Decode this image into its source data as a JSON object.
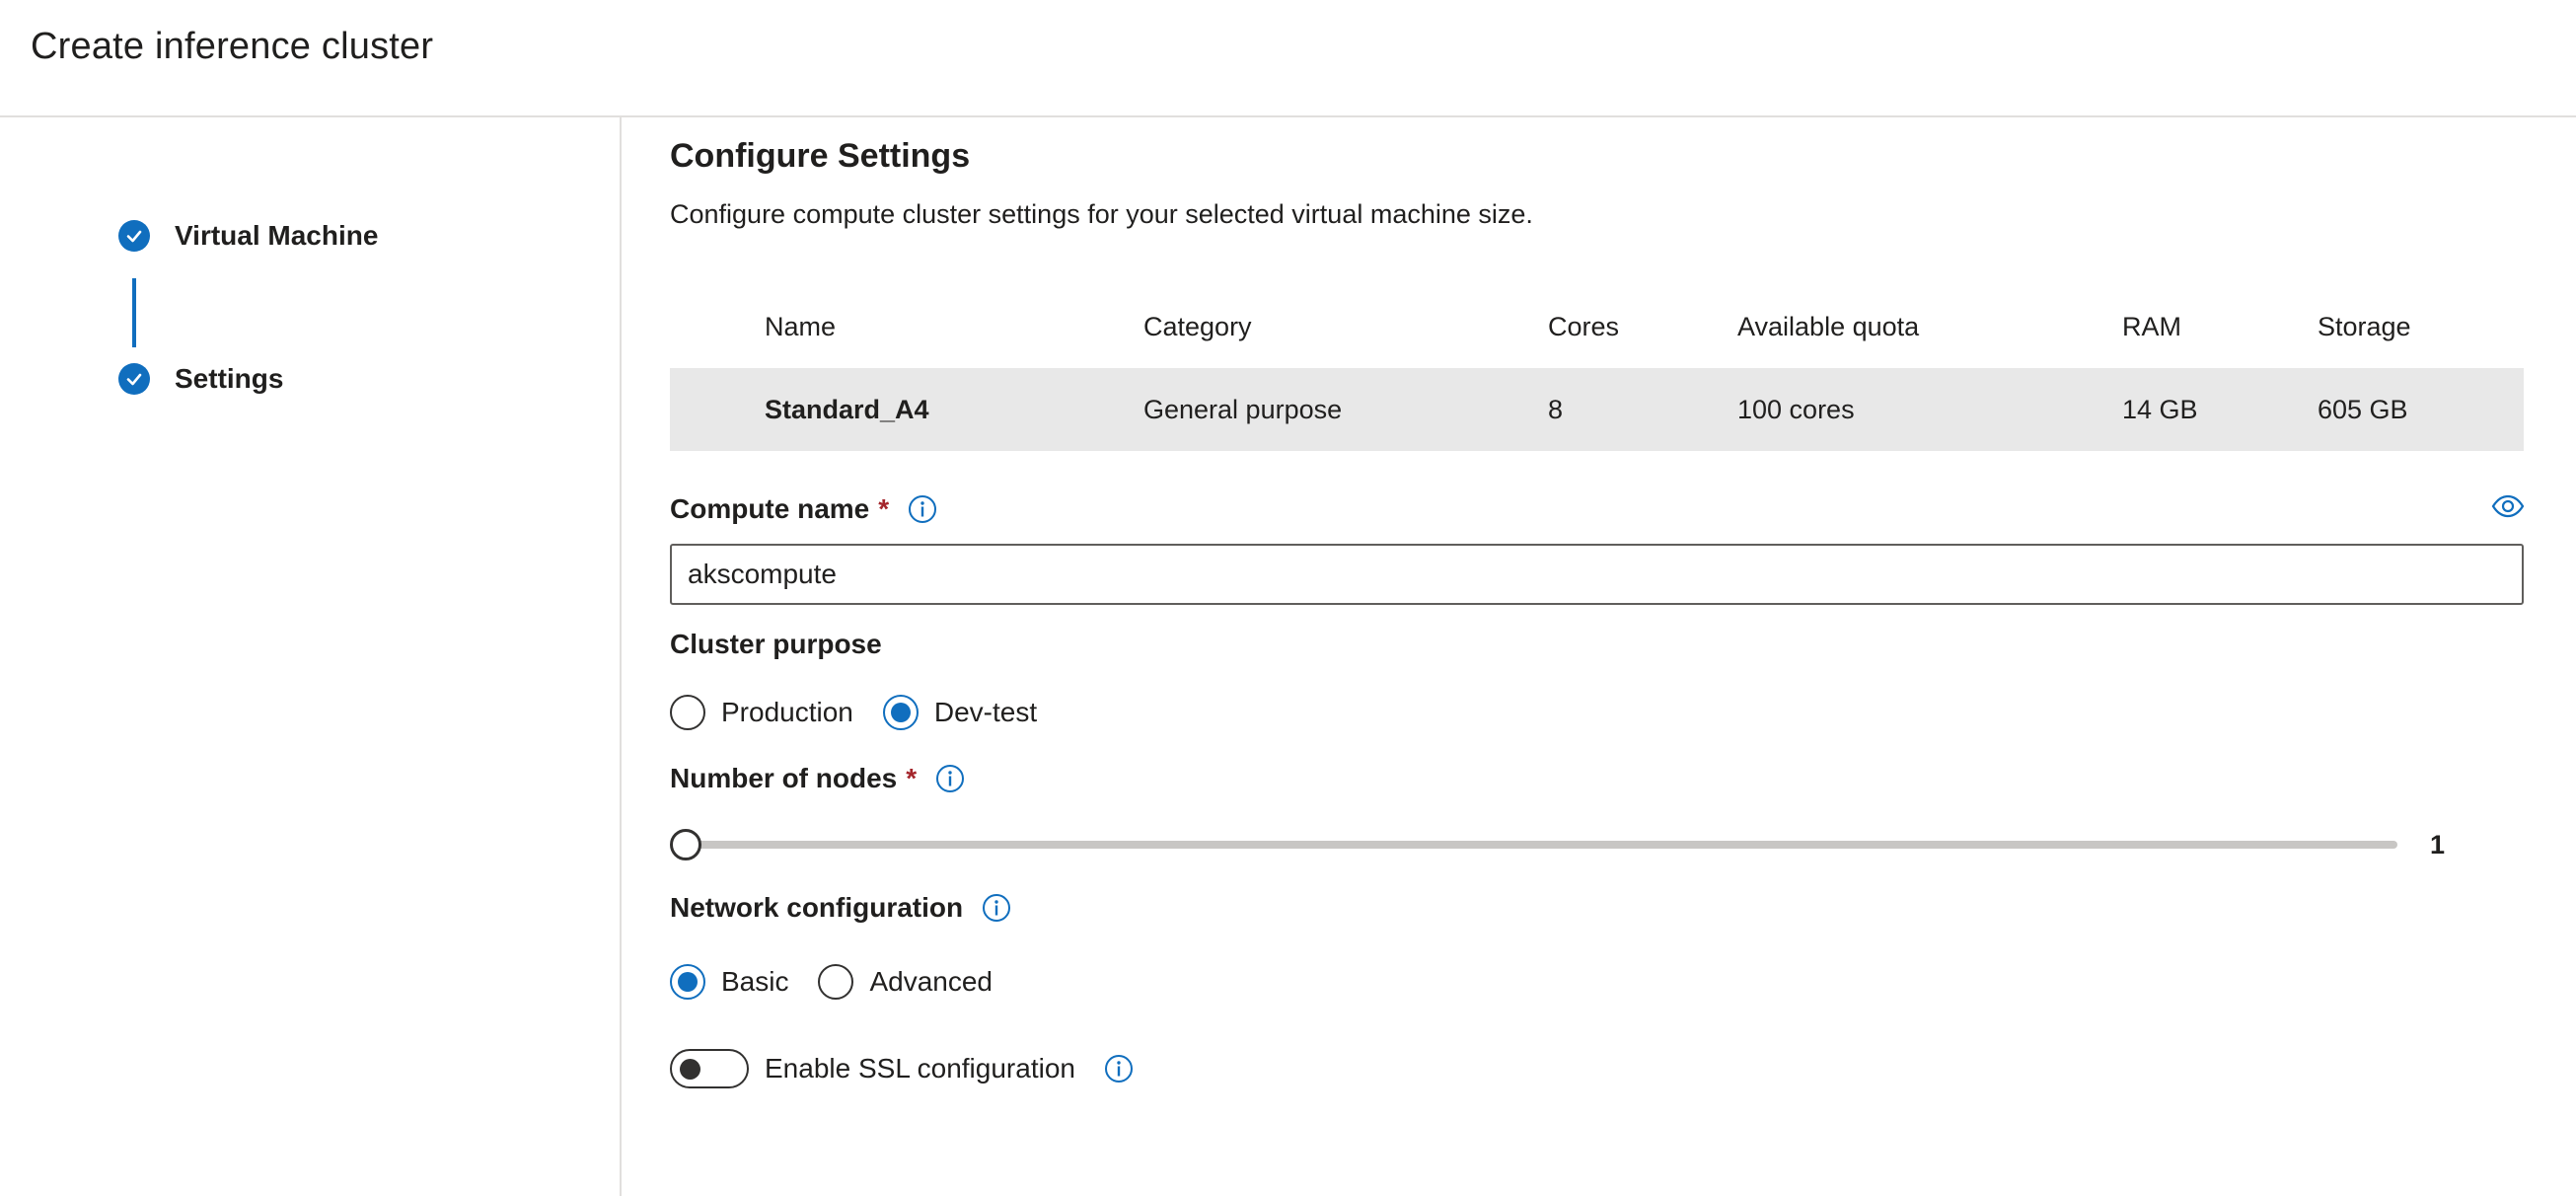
{
  "header": {
    "title": "Create inference cluster"
  },
  "wizard": {
    "steps": [
      {
        "label": "Virtual Machine",
        "status": "complete"
      },
      {
        "label": "Settings",
        "status": "complete"
      }
    ]
  },
  "main": {
    "title": "Configure Settings",
    "description": "Configure compute cluster settings for your selected virtual machine size.",
    "table": {
      "headers": [
        "Name",
        "Category",
        "Cores",
        "Available quota",
        "RAM",
        "Storage"
      ],
      "rows": [
        [
          "Standard_A4",
          "General purpose",
          "8",
          "100 cores",
          "14 GB",
          "605 GB"
        ]
      ]
    },
    "compute_name": {
      "label": "Compute name",
      "required_mark": "*",
      "value": "akscompute"
    },
    "cluster_purpose": {
      "label": "Cluster purpose",
      "options": [
        "Production",
        "Dev-test"
      ],
      "selected": "Dev-test"
    },
    "nodes": {
      "label": "Number of nodes",
      "required_mark": "*",
      "value": "1"
    },
    "network": {
      "label": "Network configuration",
      "options": [
        "Basic",
        "Advanced"
      ],
      "selected": "Basic"
    },
    "ssl": {
      "label": "Enable SSL configuration",
      "enabled": false
    }
  },
  "colors": {
    "accent": "#106ebe",
    "required": "#a4262c",
    "selected_row": "#e8e8e8"
  },
  "icons": [
    "checkmark-icon",
    "info-icon",
    "eye-icon"
  ]
}
